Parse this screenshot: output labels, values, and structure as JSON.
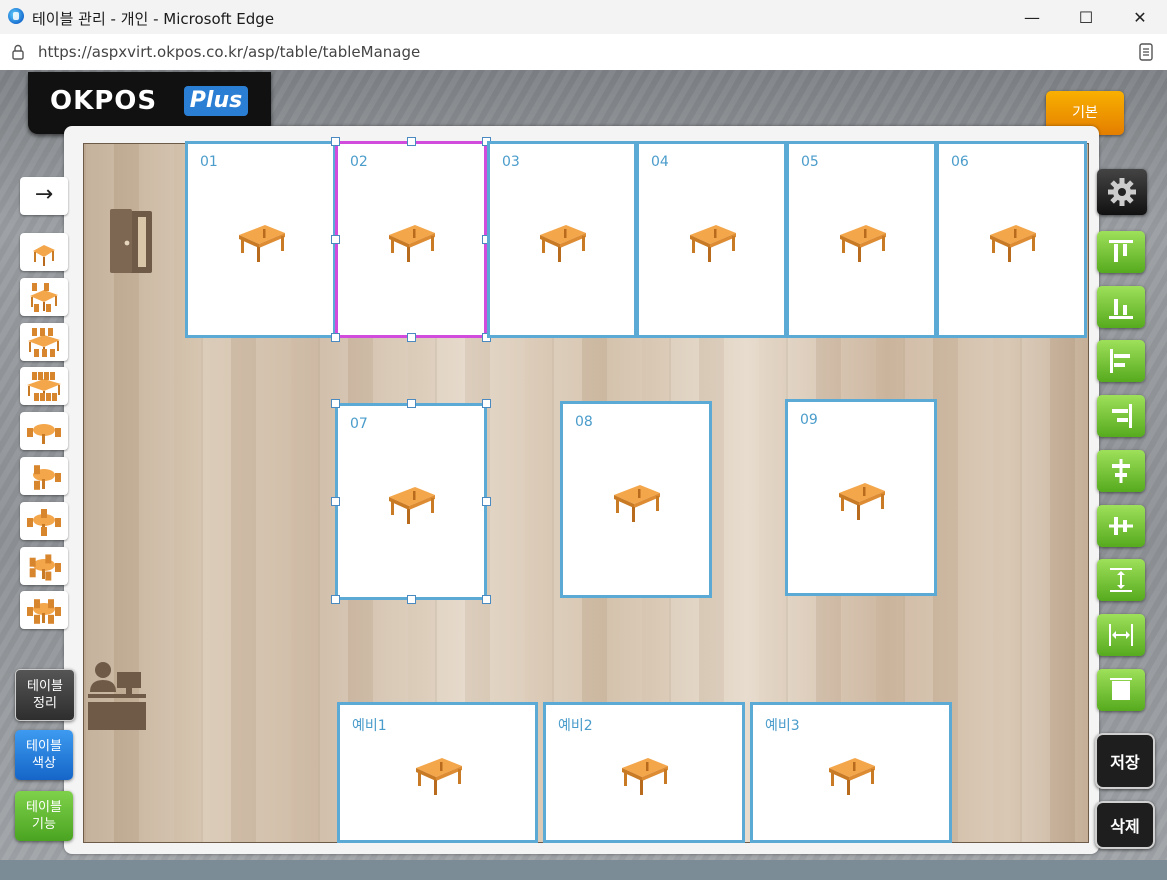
{
  "window": {
    "title": "테이블 관리 - 개인 - Microsoft Edge",
    "minimize": "—",
    "maximize": "☐",
    "close": "✕",
    "url": "https://aspxvirt.okpos.co.kr/asp/table/tableManage"
  },
  "logo": {
    "brand": "OKPOS",
    "plus": "Plus"
  },
  "header": {
    "basic_button": "기본"
  },
  "sidebar": {
    "arrow": "→",
    "buttons": {
      "arrange": "테이블\n정리",
      "color": "테이블\n색상",
      "function": "테이블\n기능"
    }
  },
  "tables": [
    {
      "label": "01"
    },
    {
      "label": "02",
      "selected": true
    },
    {
      "label": "03"
    },
    {
      "label": "04"
    },
    {
      "label": "05"
    },
    {
      "label": "06"
    },
    {
      "label": "07",
      "selected": true
    },
    {
      "label": "08"
    },
    {
      "label": "09"
    },
    {
      "label": "예비1"
    },
    {
      "label": "예비2"
    },
    {
      "label": "예비3"
    }
  ],
  "toolbar": {
    "save": "저장",
    "delete": "삭제"
  },
  "colors": {
    "table_border": "#5ba9d5",
    "selected_border": "#d14cdc",
    "basic_button": "#f39c00",
    "align_button": "#7cc83a"
  }
}
